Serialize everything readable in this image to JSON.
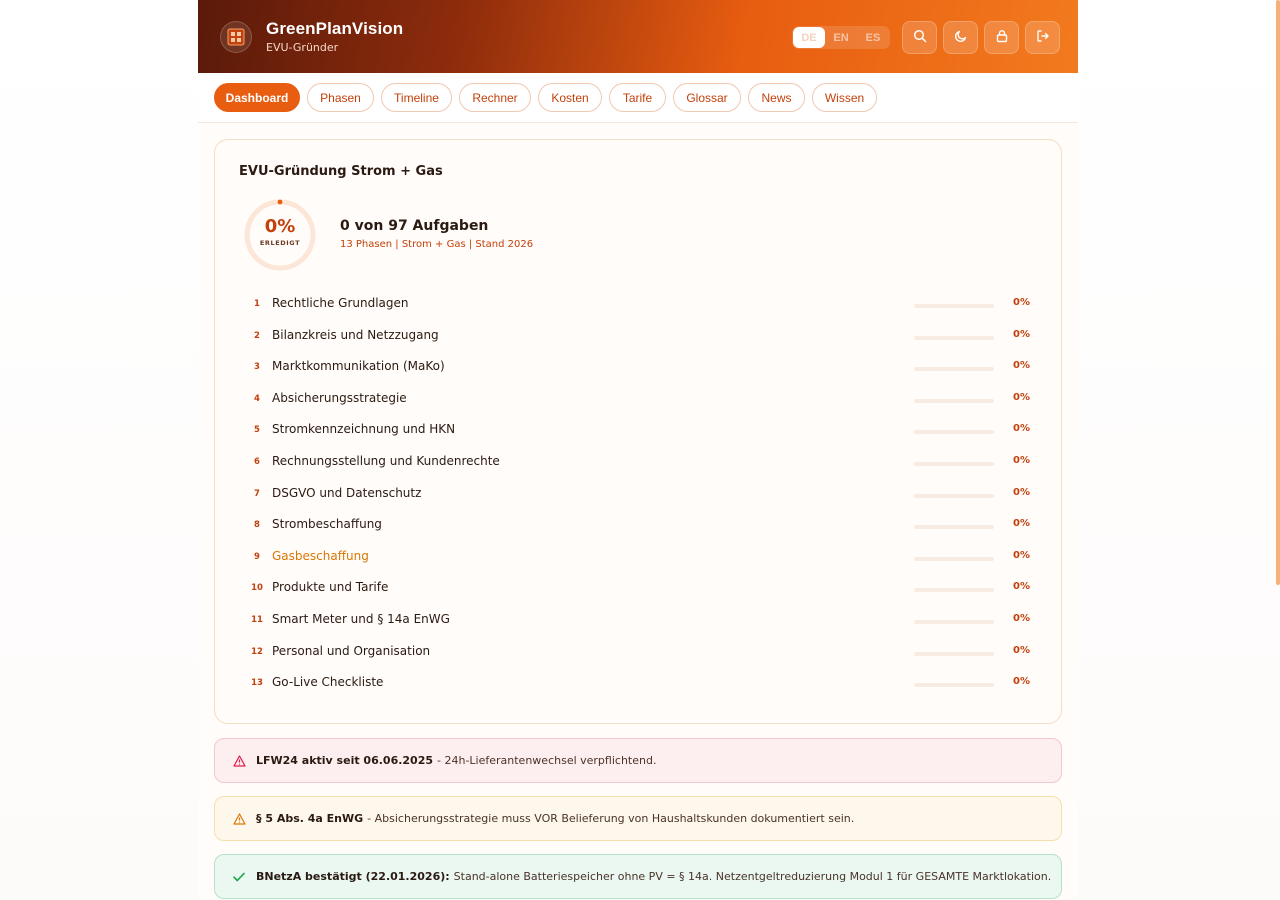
{
  "header": {
    "title": "GreenPlanVision",
    "subtitle": "EVU-Gründer",
    "languages": [
      {
        "label": "DE",
        "active": true
      },
      {
        "label": "EN",
        "active": false
      },
      {
        "label": "ES",
        "active": false
      }
    ],
    "actions": [
      "search-icon",
      "moon-icon",
      "lock-icon",
      "logout-icon"
    ]
  },
  "nav": {
    "tabs": [
      {
        "label": "Dashboard",
        "active": true
      },
      {
        "label": "Phasen",
        "active": false
      },
      {
        "label": "Timeline",
        "active": false
      },
      {
        "label": "Rechner",
        "active": false
      },
      {
        "label": "Kosten",
        "active": false
      },
      {
        "label": "Tarife",
        "active": false
      },
      {
        "label": "Glossar",
        "active": false
      },
      {
        "label": "News",
        "active": false
      },
      {
        "label": "Wissen",
        "active": false
      }
    ]
  },
  "dashboard": {
    "title": "EVU-Gründung Strom + Gas",
    "progress_percent": 0,
    "progress_label": "0%",
    "progress_caption": "ERLEDIGT",
    "tasks_summary": "0 von 97 Aufgaben",
    "meta": "13 Phasen | Strom + Gas | Stand 2026",
    "phases": [
      {
        "number": "1",
        "name": "Rechtliche Grundlagen",
        "percent_label": "0%",
        "progress": 0,
        "highlighted": false
      },
      {
        "number": "2",
        "name": "Bilanzkreis und Netzzugang",
        "percent_label": "0%",
        "progress": 0,
        "highlighted": false
      },
      {
        "number": "3",
        "name": "Marktkommunikation (MaKo)",
        "percent_label": "0%",
        "progress": 0,
        "highlighted": false
      },
      {
        "number": "4",
        "name": "Absicherungsstrategie",
        "percent_label": "0%",
        "progress": 0,
        "highlighted": false
      },
      {
        "number": "5",
        "name": "Stromkennzeichnung und HKN",
        "percent_label": "0%",
        "progress": 0,
        "highlighted": false
      },
      {
        "number": "6",
        "name": "Rechnungsstellung und Kundenrechte",
        "percent_label": "0%",
        "progress": 0,
        "highlighted": false
      },
      {
        "number": "7",
        "name": "DSGVO und Datenschutz",
        "percent_label": "0%",
        "progress": 0,
        "highlighted": false
      },
      {
        "number": "8",
        "name": "Strombeschaffung",
        "percent_label": "0%",
        "progress": 0,
        "highlighted": false
      },
      {
        "number": "9",
        "name": "Gasbeschaffung",
        "percent_label": "0%",
        "progress": 0,
        "highlighted": true
      },
      {
        "number": "10",
        "name": "Produkte und Tarife",
        "percent_label": "0%",
        "progress": 0,
        "highlighted": false
      },
      {
        "number": "11",
        "name": "Smart Meter und § 14a EnWG",
        "percent_label": "0%",
        "progress": 0,
        "highlighted": false
      },
      {
        "number": "12",
        "name": "Personal und Organisation",
        "percent_label": "0%",
        "progress": 0,
        "highlighted": false
      },
      {
        "number": "13",
        "name": "Go-Live Checkliste",
        "percent_label": "0%",
        "progress": 0,
        "highlighted": false
      }
    ]
  },
  "alerts": [
    {
      "type": "warning",
      "color": "#e11d48",
      "icon": "warning-triangle-icon",
      "title": "LFW24 aktiv seit 06.06.2025",
      "text": "- 24h-Lieferantenwechsel verpflichtend."
    },
    {
      "type": "caution",
      "color": "#d97706",
      "icon": "warning-triangle-icon",
      "title": "§ 5 Abs. 4a EnWG",
      "text": "- Absicherungsstrategie muss VOR Belieferung von Haushaltskunden dokumentiert sein."
    },
    {
      "type": "success",
      "color": "#16a34a",
      "icon": "check-icon",
      "title": "BNetzA bestätigt (22.01.2026):",
      "text": "Stand-alone Batteriespeicher ohne PV = § 14a. Netzentgeltreduzierung Modul 1 für GESAMTE Marktlokation."
    }
  ],
  "colors": {
    "accent": "#e85d10",
    "accent_dark": "#c2410c",
    "header_dark": "#5a1a0a"
  }
}
